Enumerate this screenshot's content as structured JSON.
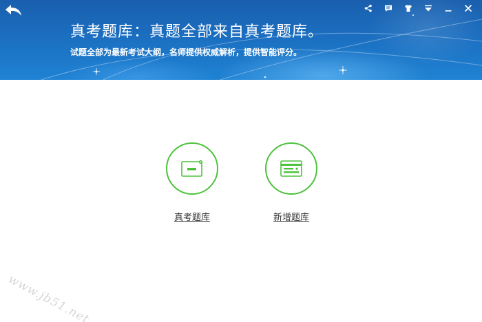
{
  "header": {
    "title": "真考题库：真题全部来自真考题库。",
    "subtitle": "试题全部为最新考试大纲，名师提供权威解析，提供智能评分。"
  },
  "toolbar": {
    "back_icon": "back-arrow-icon",
    "share_icon": "share-icon",
    "feedback_icon": "message-icon",
    "skin_icon": "tshirt-icon",
    "menu_icon": "dropdown-menu-icon",
    "minimize_icon": "minimize-icon",
    "close_icon": "close-icon"
  },
  "entries": [
    {
      "label": "真考题库",
      "icon": "exam-card-icon"
    },
    {
      "label": "新增题库",
      "icon": "new-bank-card-icon"
    }
  ],
  "watermark": {
    "text": "www.jb51.net"
  },
  "colors": {
    "header_blue": "#1b6ec0",
    "accent_green": "#4cc23b",
    "text_dark": "#333333"
  }
}
